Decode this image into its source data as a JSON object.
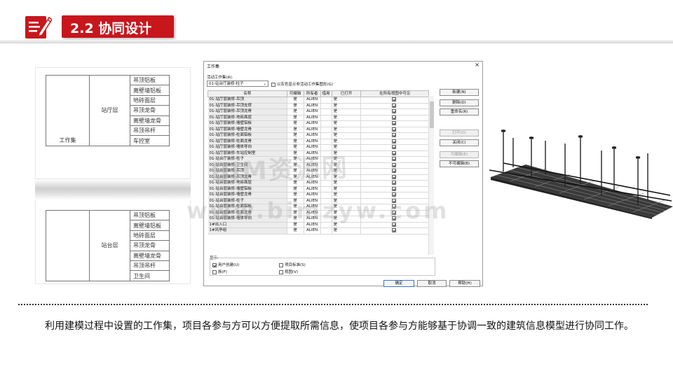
{
  "header": {
    "title": "2.2 协同设计",
    "icon": "edit-document-icon"
  },
  "colors": {
    "accent": "#c8161d"
  },
  "table_top": {
    "col1": "工作集",
    "col2": "站厅层",
    "items": [
      "吊顶铝板",
      "离壁墙铝板",
      "地砖面层",
      "吊顶龙骨",
      "离壁墙龙骨",
      "吊顶吊杆",
      "车控室"
    ]
  },
  "table_bottom": {
    "col2": "站台层",
    "items": [
      "吊顶铝板",
      "离壁墙铝板",
      "地砖面层",
      "吊顶龙骨",
      "离壁墙龙骨",
      "吊顶吊杆",
      "卫生间"
    ]
  },
  "dialog": {
    "title": "工作集",
    "active_label": "活动工作集(A):",
    "active_value": "01-站台厅装修-柱子",
    "gray_option": "以灰色显示非活动工作集图形(G)",
    "columns": [
      "名称",
      "可编辑",
      "所有者",
      "借用",
      "已打开",
      "在所有视图中可见"
    ],
    "rows": [
      {
        "name": "01-站厅层装修-吊顶",
        "editable": "是",
        "owner": "ALIEN",
        "opened": "是"
      },
      {
        "name": "01-站厅层装修-吊顶支撑",
        "editable": "是",
        "owner": "ALIEN",
        "opened": "是"
      },
      {
        "name": "01-站厅层装修-吊顶龙骨",
        "editable": "是",
        "owner": "ALIEN",
        "opened": "是"
      },
      {
        "name": "01-站厅层装修-地砖面层",
        "editable": "是",
        "owner": "ALIEN",
        "opened": "是"
      },
      {
        "name": "01-站厅层装修-墙壁铝板",
        "editable": "是",
        "owner": "ALIEN",
        "opened": "是"
      },
      {
        "name": "01-站厅层装修-墙壁龙骨",
        "editable": "是",
        "owner": "ALIEN",
        "opened": "是"
      },
      {
        "name": "01-站厅层装修-柱面铝板",
        "editable": "是",
        "owner": "ALIEN",
        "opened": "是"
      },
      {
        "name": "01-站厅层装修-柱面龙骨",
        "editable": "是",
        "owner": "ALIEN",
        "opened": "是"
      },
      {
        "name": "01-站厅层装修-墙体导向",
        "editable": "是",
        "owner": "ALIEN",
        "opened": "是"
      },
      {
        "name": "01-站厅层装修-车站控制室",
        "editable": "是",
        "owner": "ALIEN",
        "opened": "是"
      },
      {
        "name": "01-站台厅装修-柱子",
        "editable": "是",
        "owner": "ALIEN",
        "opened": "是"
      },
      {
        "name": "01-站台层装修-卫生间",
        "editable": "是",
        "owner": "ALIEN",
        "opened": "是"
      },
      {
        "name": "01-站台层装修-吊顶",
        "editable": "是",
        "owner": "ALIEN",
        "opened": "是"
      },
      {
        "name": "01-站台层装修-吊顶龙骨",
        "editable": "是",
        "owner": "ALIEN",
        "opened": "是"
      },
      {
        "name": "01-站台层装修-地砖面层",
        "editable": "是",
        "owner": "ALIEN",
        "opened": "是"
      },
      {
        "name": "01-站台层装修-墙壁铝板",
        "editable": "是",
        "owner": "ALIEN",
        "opened": "是"
      },
      {
        "name": "01-站台层装修-墙壁龙骨",
        "editable": "是",
        "owner": "ALIEN",
        "opened": "是"
      },
      {
        "name": "01-站台层装修-柱子",
        "editable": "是",
        "owner": "ALIEN",
        "opened": "是"
      },
      {
        "name": "01-站台层装修-柱面铝板",
        "editable": "是",
        "owner": "ALIEN",
        "opened": "是"
      },
      {
        "name": "01-站台层装修-柱面龙骨",
        "editable": "是",
        "owner": "ALIEN",
        "opened": "是"
      },
      {
        "name": "01-站台层装修-墙体导向",
        "editable": "是",
        "owner": "ALIEN",
        "opened": "是"
      },
      {
        "name": "1#出入口",
        "editable": "是",
        "owner": "ALIEN",
        "opened": "是"
      },
      {
        "name": "1#风亭组",
        "editable": "是",
        "owner": "ALIEN",
        "opened": "是"
      }
    ],
    "buttons": {
      "new": "新建(N)",
      "delete": "删除(D)",
      "rename": "重命名(R)",
      "open": "打开(O)",
      "close": "关闭(C)",
      "editable": "可编辑(E)",
      "non_editable": "不可编辑(B)"
    },
    "display": {
      "label": "显示:",
      "user_created": "用户创建(U)",
      "project_std": "项目标准(S)",
      "families": "族(F)",
      "views": "视图(V)"
    },
    "ok": "确定",
    "cancel": "取消",
    "help": "帮助(H)"
  },
  "watermark": {
    "line1": "BIM资源网",
    "line2": "www.bimzyw.com"
  },
  "body_text": "利用建模过程中设置的工作集，项目各参与方可以方便提取所需信息，使项目各参与方能够基于协调一致的建筑信息模型进行协同工作。"
}
